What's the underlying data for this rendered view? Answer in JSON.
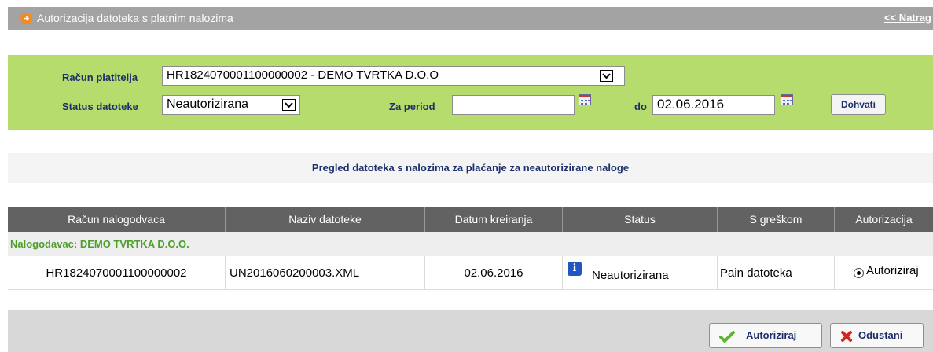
{
  "header": {
    "title": "Autorizacija datoteka s platnim nalozima",
    "back_link": "<< Natrag"
  },
  "filters": {
    "payer_account_label": "Račun platitelja",
    "payer_account_value": "HR1824070001100000002 - DEMO TVRTKA D.O.O",
    "file_status_label": "Status datoteke",
    "file_status_value": "Neautorizirana",
    "period_label": "Za period",
    "period_from_value": "",
    "period_to_label": "do",
    "period_to_value": "02.06.2016",
    "fetch_button": "Dohvati"
  },
  "section_caption": "Pregled datoteka s nalozima za plaćanje za neautorizirane naloge",
  "table": {
    "columns": [
      "Račun nalogodvaca",
      "Naziv datoteke",
      "Datum kreiranja",
      "Status",
      "S greškom",
      "Autorizacija"
    ],
    "group_label": "Nalogodavac: DEMO TVRTKA D.O.O.",
    "rows": [
      {
        "account": "HR1824070001100000002",
        "file_name": "UN2016060200003.XML",
        "created": "02.06.2016",
        "status": "Neautorizirana",
        "error": "Pain datoteka",
        "authorization": "Autoriziraj"
      }
    ]
  },
  "footer": {
    "authorize_button": "Autoriziraj",
    "cancel_button": "Odustani"
  },
  "colors": {
    "filter_panel": "#b5dc6c",
    "title_bar": "#a3a3a3",
    "table_header": "#626262",
    "group_label": "#4d9e2a"
  }
}
